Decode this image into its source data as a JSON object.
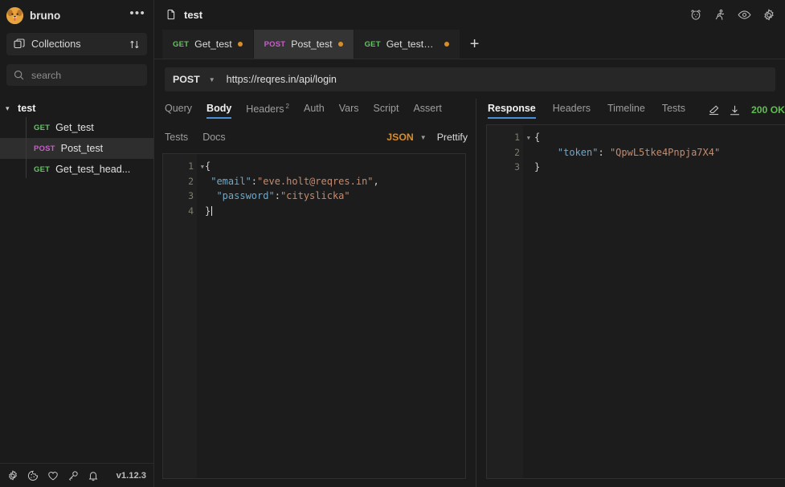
{
  "app": {
    "name": "bruno",
    "version": "v1.12.3",
    "more_label": "•••"
  },
  "sidebar": {
    "collections_button": {
      "label": "Collections",
      "icon": "collections-icon",
      "sort_icon": "sort-arrows-icon"
    },
    "search": {
      "placeholder": "search",
      "value": "",
      "icon": "search-icon"
    },
    "collection": {
      "name": "test",
      "expanded": true,
      "items": [
        {
          "method": "GET",
          "name": "Get_test",
          "active": false
        },
        {
          "method": "POST",
          "name": "Post_test",
          "active": true
        },
        {
          "method": "GET",
          "name": "Get_test_head...",
          "active": false
        }
      ]
    },
    "footer_icons": [
      "gear-icon",
      "cookie-icon",
      "heart-icon",
      "key-icon",
      "bell-icon"
    ]
  },
  "topbar": {
    "collection_title": "test",
    "collection_icon": "copy-icon",
    "right_icons": [
      "dog-icon",
      "runner-icon",
      "eye-icon",
      "gear-icon"
    ]
  },
  "tabs": {
    "items": [
      {
        "method": "GET",
        "name": "Get_test",
        "active": false,
        "dirty": true
      },
      {
        "method": "POST",
        "name": "Post_test",
        "active": true,
        "dirty": true
      },
      {
        "method": "GET",
        "name": "Get_test_h...",
        "active": false,
        "dirty": true
      }
    ],
    "new_tab_label": "+"
  },
  "request": {
    "method": "POST",
    "url": "https://reqres.in/api/login",
    "pane_tabs": [
      {
        "label": "Query",
        "active": false
      },
      {
        "label": "Body",
        "active": true
      },
      {
        "label": "Headers",
        "active": false,
        "badge": "2"
      },
      {
        "label": "Auth",
        "active": false
      },
      {
        "label": "Vars",
        "active": false
      },
      {
        "label": "Script",
        "active": false
      },
      {
        "label": "Assert",
        "active": false
      },
      {
        "label": "Tests",
        "active": false
      },
      {
        "label": "Docs",
        "active": false
      }
    ],
    "body_format": "JSON",
    "prettify_label": "Prettify",
    "body_lines": [
      {
        "n": "1",
        "fold": true,
        "tokens": [
          {
            "t": "{",
            "c": "p"
          }
        ]
      },
      {
        "n": "2",
        "fold": false,
        "tokens": [
          {
            "t": " \"email\"",
            "c": "k"
          },
          {
            "t": ":",
            "c": "p"
          },
          {
            "t": "\"eve.holt@reqres.in\"",
            "c": "s"
          },
          {
            "t": ",",
            "c": "p"
          }
        ]
      },
      {
        "n": "3",
        "fold": false,
        "tokens": [
          {
            "t": "  \"password\"",
            "c": "k"
          },
          {
            "t": ":",
            "c": "p"
          },
          {
            "t": "\"cityslicka\"",
            "c": "s"
          }
        ]
      },
      {
        "n": "4",
        "fold": false,
        "tokens": [
          {
            "t": "}",
            "c": "p"
          }
        ]
      }
    ]
  },
  "response": {
    "pane_tabs": [
      {
        "label": "Response",
        "active": true
      },
      {
        "label": "Headers",
        "active": false
      },
      {
        "label": "Timeline",
        "active": false
      },
      {
        "label": "Tests",
        "active": false
      }
    ],
    "action_icons": [
      "clear-icon",
      "download-icon"
    ],
    "status": "200 OK",
    "status_color": "#5bbf4e",
    "body_lines": [
      {
        "n": "1",
        "fold": true,
        "tokens": [
          {
            "t": "{",
            "c": "p"
          }
        ]
      },
      {
        "n": "2",
        "fold": false,
        "tokens": [
          {
            "t": "    \"token\"",
            "c": "k"
          },
          {
            "t": ": ",
            "c": "p"
          },
          {
            "t": "\"QpwL5tke4Pnpja7X4\"",
            "c": "s"
          }
        ]
      },
      {
        "n": "3",
        "fold": false,
        "tokens": [
          {
            "t": "}",
            "c": "p"
          }
        ]
      }
    ]
  }
}
